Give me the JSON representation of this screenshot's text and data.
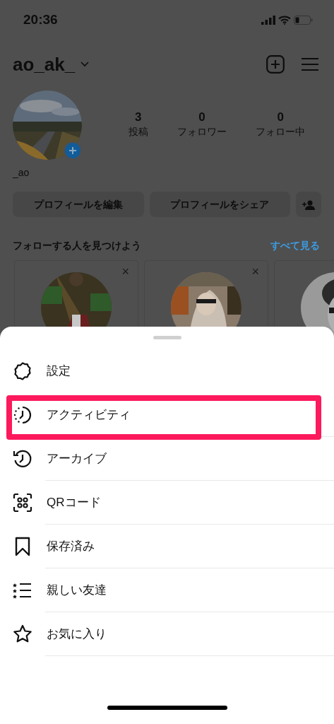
{
  "status_bar": {
    "time": "20:36"
  },
  "header": {
    "username": "ao_ak_"
  },
  "profile": {
    "display_name": "_ao",
    "stats": [
      {
        "count": "3",
        "label": "投稿"
      },
      {
        "count": "0",
        "label": "フォロワー"
      },
      {
        "count": "0",
        "label": "フォロー中"
      }
    ],
    "buttons": [
      "プロフィールを編集",
      "プロフィールをシェア"
    ]
  },
  "suggestions": {
    "title": "フォローする人を見つけよう",
    "see_all": "すべて見る",
    "cards": [
      {
        "kind": "picture",
        "close": "×"
      },
      {
        "kind": "picture",
        "close": "×"
      },
      {
        "kind": "picture"
      }
    ]
  },
  "menu": {
    "items": [
      {
        "label": "設定",
        "highlighted": false
      },
      {
        "label": "アクティビティ",
        "highlighted": true
      },
      {
        "label": "アーカイブ",
        "highlighted": false
      },
      {
        "label": "QRコード",
        "highlighted": false
      },
      {
        "label": "保存済み",
        "highlighted": false
      },
      {
        "label": "親しい友達",
        "highlighted": false
      },
      {
        "label": "お気に入り",
        "highlighted": false
      }
    ]
  }
}
